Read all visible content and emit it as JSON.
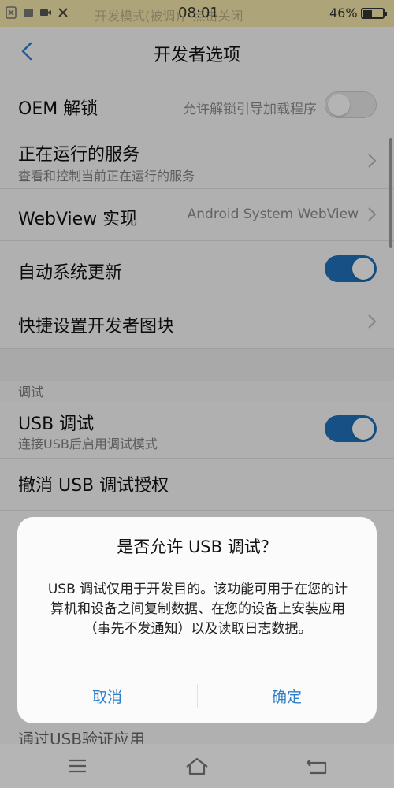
{
  "status_bar": {
    "notice": "开发模式(被调)，点击关闭",
    "time": "08:01",
    "battery_text": "46%",
    "battery_level": 0.46
  },
  "header": {
    "title": "开发者选项"
  },
  "rows": {
    "oem_unlock": {
      "title": "OEM 解锁",
      "value": "允许解锁引导加载程序",
      "enabled": false
    },
    "running_services": {
      "title": "正在运行的服务",
      "subtitle": "查看和控制当前正在运行的服务"
    },
    "webview": {
      "title": "WebView 实现",
      "value": "Android System WebView"
    },
    "auto_update": {
      "title": "自动系统更新",
      "enabled": true
    },
    "quick_tiles": {
      "title": "快捷设置开发者图块"
    },
    "section_debug": "调试",
    "usb_debug": {
      "title": "USB 调试",
      "subtitle": "连接USB后启用调试模式",
      "enabled": true
    },
    "revoke_usb": {
      "title": "撤消 USB 调试授权"
    },
    "verify_usb_apps": {
      "title": "通过USB验证应用"
    }
  },
  "dialog": {
    "title": "是否允许 USB 调试？",
    "body": "USB 调试仅用于开发目的。该功能可用于在您的计算机和设备之间复制数据、在您的设备上安装应用（事先不发通知）以及读取日志数据。",
    "cancel": "取消",
    "confirm": "确定"
  },
  "nav": {
    "icons": [
      "menu-icon",
      "home-icon",
      "back-icon"
    ]
  },
  "colors": {
    "accent": "#1f6fb8",
    "dialog_button": "#2f7fc9"
  }
}
